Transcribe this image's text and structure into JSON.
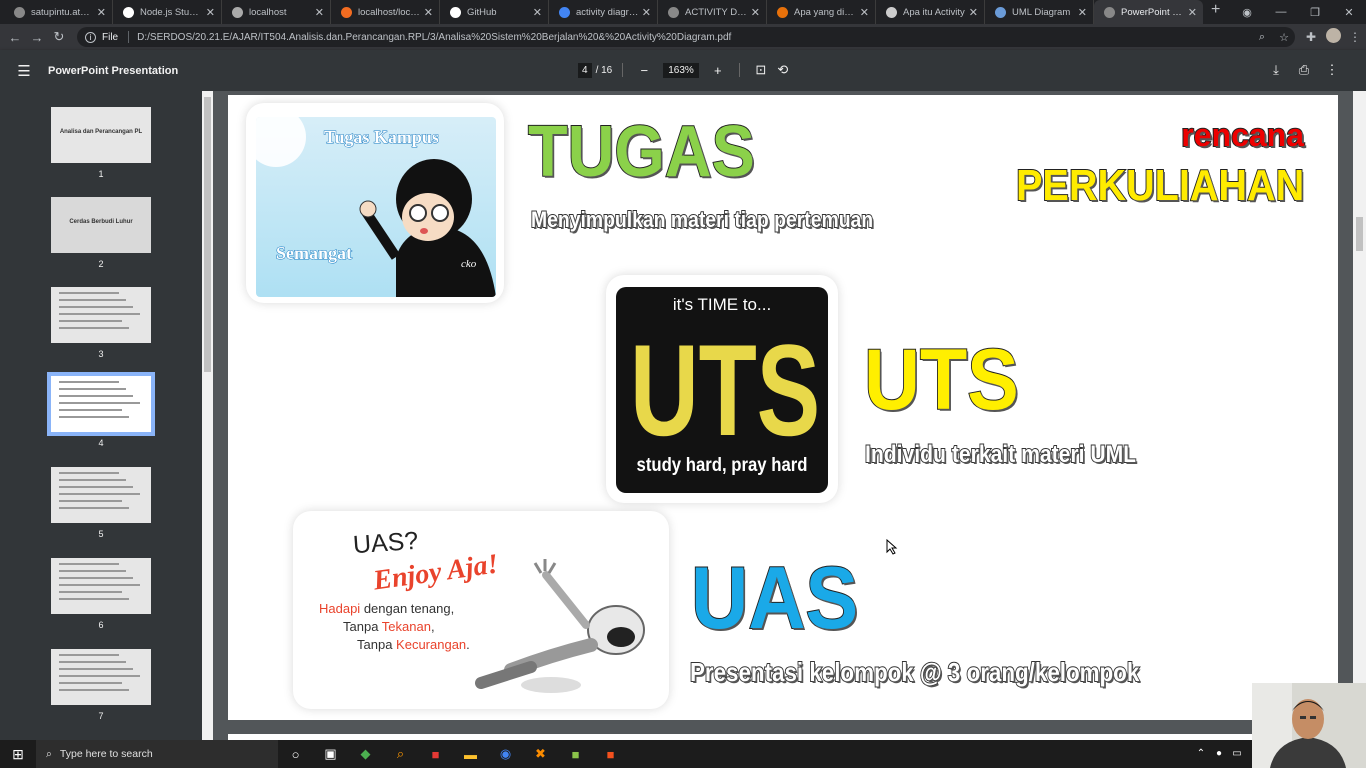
{
  "browser": {
    "tabs": [
      {
        "title": "satupintu.atmaluhur",
        "color": "#888",
        "active": false
      },
      {
        "title": "Node.js Study | Dash",
        "color": "#fff",
        "active": false
      },
      {
        "title": "localhost",
        "color": "#aaa",
        "active": false
      },
      {
        "title": "localhost/localhost/",
        "color": "#f26c21",
        "active": false
      },
      {
        "title": "GitHub",
        "color": "#fff",
        "active": false
      },
      {
        "title": "activity diagram",
        "color": "#4285f4",
        "active": false
      },
      {
        "title": "ACTIVITY DIAGRAM",
        "color": "#888",
        "active": false
      },
      {
        "title": "Apa yang dimaksud",
        "color": "#e8710a",
        "active": false
      },
      {
        "title": "Apa itu Activity",
        "color": "#ccc",
        "active": false
      },
      {
        "title": "UML Diagram",
        "color": "#6a9bd8",
        "active": false
      },
      {
        "title": "PowerPoint Presentation",
        "color": "#888",
        "active": true
      }
    ],
    "file_label": "File",
    "url": "D:/SERDOS/20.21.E/AJAR/IT504.Analisis.dan.Perancangan.RPL/3/Analisa%20Sistem%20Berjalan%20&%20Activity%20Diagram.pdf"
  },
  "pdf": {
    "title": "PowerPoint Presentation",
    "page_current": "4",
    "page_total": "/ 16",
    "zoom": "163%",
    "thumbnails": [
      {
        "num": "1",
        "text": "Analisa dan Perancangan PL"
      },
      {
        "num": "2",
        "text": "Cerdas Berbudi Luhur"
      },
      {
        "num": "3",
        "text": ""
      },
      {
        "num": "4",
        "text": ""
      },
      {
        "num": "5",
        "text": ""
      },
      {
        "num": "6",
        "text": ""
      },
      {
        "num": "7",
        "text": ""
      }
    ]
  },
  "slide": {
    "tugas_kampus": "Tugas Kampus",
    "semangat": "Semangat",
    "cko": "cko",
    "tugas": "TUGAS",
    "tugas_desc": "Menyimpulkan materi tiap pertemuan",
    "rencana": "rencana",
    "perkuliahan": "PERKULIAHAN",
    "its_time": "it's TIME to...",
    "study_hard": "study hard, pray hard",
    "uts": "UTS",
    "uts_desc": "Individu terkait materi UML",
    "uas_q": "UAS?",
    "enjoy": "Enjoy Aja!",
    "line1_red": "Hadapi",
    "line1": " dengan tenang,",
    "line2": "Tanpa ",
    "line2_red": "Tekanan",
    "line2_end": ",",
    "line3": "Tanpa ",
    "line3_red": "Kecurangan",
    "line3_end": ".",
    "uas": "UAS",
    "uas_desc": "Presentasi kelompok @ 3 orang/kelompok"
  },
  "taskbar": {
    "search_placeholder": "Type here to search"
  }
}
